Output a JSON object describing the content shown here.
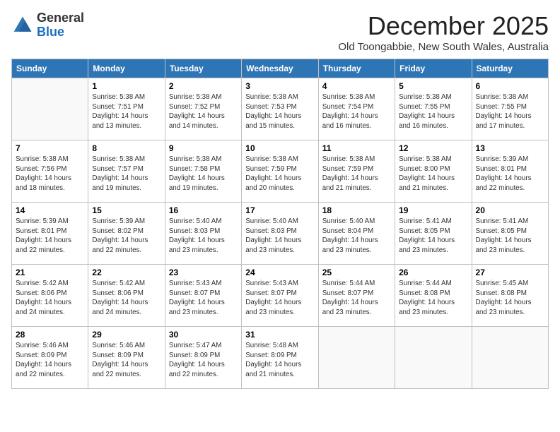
{
  "logo": {
    "general": "General",
    "blue": "Blue"
  },
  "title": "December 2025",
  "subtitle": "Old Toongabbie, New South Wales, Australia",
  "days_of_week": [
    "Sunday",
    "Monday",
    "Tuesday",
    "Wednesday",
    "Thursday",
    "Friday",
    "Saturday"
  ],
  "weeks": [
    [
      {
        "day": "",
        "info": ""
      },
      {
        "day": "1",
        "info": "Sunrise: 5:38 AM\nSunset: 7:51 PM\nDaylight: 14 hours\nand 13 minutes."
      },
      {
        "day": "2",
        "info": "Sunrise: 5:38 AM\nSunset: 7:52 PM\nDaylight: 14 hours\nand 14 minutes."
      },
      {
        "day": "3",
        "info": "Sunrise: 5:38 AM\nSunset: 7:53 PM\nDaylight: 14 hours\nand 15 minutes."
      },
      {
        "day": "4",
        "info": "Sunrise: 5:38 AM\nSunset: 7:54 PM\nDaylight: 14 hours\nand 16 minutes."
      },
      {
        "day": "5",
        "info": "Sunrise: 5:38 AM\nSunset: 7:55 PM\nDaylight: 14 hours\nand 16 minutes."
      },
      {
        "day": "6",
        "info": "Sunrise: 5:38 AM\nSunset: 7:55 PM\nDaylight: 14 hours\nand 17 minutes."
      }
    ],
    [
      {
        "day": "7",
        "info": "Sunrise: 5:38 AM\nSunset: 7:56 PM\nDaylight: 14 hours\nand 18 minutes."
      },
      {
        "day": "8",
        "info": "Sunrise: 5:38 AM\nSunset: 7:57 PM\nDaylight: 14 hours\nand 19 minutes."
      },
      {
        "day": "9",
        "info": "Sunrise: 5:38 AM\nSunset: 7:58 PM\nDaylight: 14 hours\nand 19 minutes."
      },
      {
        "day": "10",
        "info": "Sunrise: 5:38 AM\nSunset: 7:59 PM\nDaylight: 14 hours\nand 20 minutes."
      },
      {
        "day": "11",
        "info": "Sunrise: 5:38 AM\nSunset: 7:59 PM\nDaylight: 14 hours\nand 21 minutes."
      },
      {
        "day": "12",
        "info": "Sunrise: 5:38 AM\nSunset: 8:00 PM\nDaylight: 14 hours\nand 21 minutes."
      },
      {
        "day": "13",
        "info": "Sunrise: 5:39 AM\nSunset: 8:01 PM\nDaylight: 14 hours\nand 22 minutes."
      }
    ],
    [
      {
        "day": "14",
        "info": "Sunrise: 5:39 AM\nSunset: 8:01 PM\nDaylight: 14 hours\nand 22 minutes."
      },
      {
        "day": "15",
        "info": "Sunrise: 5:39 AM\nSunset: 8:02 PM\nDaylight: 14 hours\nand 22 minutes."
      },
      {
        "day": "16",
        "info": "Sunrise: 5:40 AM\nSunset: 8:03 PM\nDaylight: 14 hours\nand 23 minutes."
      },
      {
        "day": "17",
        "info": "Sunrise: 5:40 AM\nSunset: 8:03 PM\nDaylight: 14 hours\nand 23 minutes."
      },
      {
        "day": "18",
        "info": "Sunrise: 5:40 AM\nSunset: 8:04 PM\nDaylight: 14 hours\nand 23 minutes."
      },
      {
        "day": "19",
        "info": "Sunrise: 5:41 AM\nSunset: 8:05 PM\nDaylight: 14 hours\nand 23 minutes."
      },
      {
        "day": "20",
        "info": "Sunrise: 5:41 AM\nSunset: 8:05 PM\nDaylight: 14 hours\nand 23 minutes."
      }
    ],
    [
      {
        "day": "21",
        "info": "Sunrise: 5:42 AM\nSunset: 8:06 PM\nDaylight: 14 hours\nand 24 minutes."
      },
      {
        "day": "22",
        "info": "Sunrise: 5:42 AM\nSunset: 8:06 PM\nDaylight: 14 hours\nand 24 minutes."
      },
      {
        "day": "23",
        "info": "Sunrise: 5:43 AM\nSunset: 8:07 PM\nDaylight: 14 hours\nand 23 minutes."
      },
      {
        "day": "24",
        "info": "Sunrise: 5:43 AM\nSunset: 8:07 PM\nDaylight: 14 hours\nand 23 minutes."
      },
      {
        "day": "25",
        "info": "Sunrise: 5:44 AM\nSunset: 8:07 PM\nDaylight: 14 hours\nand 23 minutes."
      },
      {
        "day": "26",
        "info": "Sunrise: 5:44 AM\nSunset: 8:08 PM\nDaylight: 14 hours\nand 23 minutes."
      },
      {
        "day": "27",
        "info": "Sunrise: 5:45 AM\nSunset: 8:08 PM\nDaylight: 14 hours\nand 23 minutes."
      }
    ],
    [
      {
        "day": "28",
        "info": "Sunrise: 5:46 AM\nSunset: 8:09 PM\nDaylight: 14 hours\nand 22 minutes."
      },
      {
        "day": "29",
        "info": "Sunrise: 5:46 AM\nSunset: 8:09 PM\nDaylight: 14 hours\nand 22 minutes."
      },
      {
        "day": "30",
        "info": "Sunrise: 5:47 AM\nSunset: 8:09 PM\nDaylight: 14 hours\nand 22 minutes."
      },
      {
        "day": "31",
        "info": "Sunrise: 5:48 AM\nSunset: 8:09 PM\nDaylight: 14 hours\nand 21 minutes."
      },
      {
        "day": "",
        "info": ""
      },
      {
        "day": "",
        "info": ""
      },
      {
        "day": "",
        "info": ""
      }
    ]
  ]
}
